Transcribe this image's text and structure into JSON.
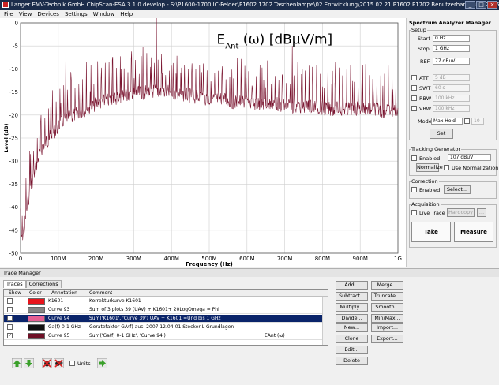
{
  "window": {
    "title": "Langer EMV-Technik GmbH ChipScan-ESA 3.1.0 develop - S:\\P1600-1700 IC-Felder\\P1602 1702 Taschenlampe\\02 Entwicklung\\2015.02.21 P1602 P1702 Benutzerhandbuch\\2015.04.24-01 IC..."
  },
  "menu": [
    "File",
    "View",
    "Devices",
    "Settings",
    "Window",
    "Help"
  ],
  "chart_data": {
    "type": "line",
    "title": "E",
    "title_sub": "Ant",
    "title_rest": " (ω) [dBµV/m]",
    "xlabel": "Frequency (Hz)",
    "ylabel": "Level (dB)",
    "xlim": [
      0,
      1000
    ],
    "ylim": [
      -50,
      0
    ],
    "x_ticks": [
      "0",
      "100M",
      "200M",
      "300M",
      "400M",
      "500M",
      "600M",
      "700M",
      "800M",
      "900M",
      "1G"
    ],
    "y_ticks": [
      "0",
      "-5",
      "-10",
      "-15",
      "-20",
      "-25",
      "-30",
      "-35",
      "-40",
      "-45",
      "-50"
    ],
    "grid": true,
    "series": [
      {
        "color": "#7a1530",
        "x": [
          0,
          10,
          20,
          30,
          40,
          50,
          60,
          70,
          80,
          90,
          100,
          120,
          140,
          160,
          180,
          200,
          220,
          240,
          260,
          280,
          300,
          320,
          340,
          360,
          380,
          400,
          420,
          440,
          460,
          480,
          500,
          520,
          540,
          560,
          580,
          600,
          620,
          640,
          660,
          680,
          700,
          720,
          740,
          760,
          780,
          800,
          820,
          840,
          860,
          880,
          900,
          920,
          940,
          960,
          980,
          1000
        ],
        "y": [
          -46,
          -43,
          -37,
          -33,
          -30,
          -27,
          -25,
          -24,
          -23,
          -22,
          -21,
          -19,
          -18.5,
          -17.5,
          -17,
          -16,
          -15.5,
          -15,
          -14.5,
          -14,
          -14,
          -13.5,
          -13.5,
          -13,
          -13.5,
          -13.5,
          -14,
          -14,
          -14.5,
          -14.5,
          -15,
          -15,
          -15,
          -15.5,
          -15.5,
          -15.5,
          -16,
          -16,
          -16,
          -16,
          -16.5,
          -16.5,
          -16.5,
          -16.5,
          -16.5,
          -17,
          -17,
          -17,
          -17,
          -17,
          -17,
          -17,
          -17,
          -17.5,
          -17.5,
          -17
        ]
      }
    ],
    "peaks": [
      {
        "x": 360,
        "y": 3
      },
      {
        "x": 120,
        "y": -6
      },
      {
        "x": 243,
        "y": -8
      },
      {
        "x": 301,
        "y": -12
      },
      {
        "x": 375,
        "y": -11
      },
      {
        "x": 412,
        "y": -11
      },
      {
        "x": 720,
        "y": -5
      },
      {
        "x": 598,
        "y": -12
      },
      {
        "x": 650,
        "y": -14
      },
      {
        "x": 833,
        "y": -13
      }
    ]
  },
  "analyzer": {
    "panel_title": "Spectrum Analyzer Manager",
    "setup_label": "Setup",
    "start_label": "Start",
    "start_value": "0 Hz",
    "stop_label": "Stop",
    "stop_value": "1 GHz",
    "ref_label": "REF",
    "ref_value": "77 dBuV",
    "att_label": "ATT",
    "att_value": "5 dB",
    "swt_label": "SWT",
    "swt_value": "60 s",
    "rbw_label": "RBW",
    "rbw_value": "100 kHz",
    "vbw_label": "VBW",
    "vbw_value": "100 kHz",
    "mode_label": "Mode",
    "mode_value": "Max Hold",
    "mode_count": "10",
    "set_label": "Set",
    "tracking_label": "Tracking Generator",
    "tg_enabled_label": "Enabled",
    "tg_level": "107 dBuV",
    "normalize_label": "Normalize",
    "use_norm_label": "Use Normalization",
    "correction_label": "Correction",
    "corr_enabled_label": "Enabled",
    "select_label": "Select...",
    "acquisition_label": "Acquisition",
    "live_trace_label": "Live Trace",
    "hardcopy_label": "Hardcopy",
    "take_label": "Take",
    "measure_label": "Measure"
  },
  "trace_manager": {
    "title": "Trace Manager",
    "tabs": [
      "Traces",
      "Corrections"
    ],
    "headers": [
      "Show",
      "Color",
      "Annotation",
      "Comment"
    ],
    "rows": [
      {
        "checked": false,
        "color": "#e8141c",
        "annotation": "K1601",
        "comment": "Korrekturkurve K1601",
        "extra": ""
      },
      {
        "checked": false,
        "color": "#848484",
        "annotation": "Curve 93",
        "comment": "Sum of 3 plots 39 (UAV) + K1601+ 20LogOmega = Phi",
        "extra": ""
      },
      {
        "checked": false,
        "color": "#e55f93",
        "annotation": "Curve 94",
        "comment": "Sum('K1601', 'Curve 39') UAV + K1601 =Und bis 1 GHz",
        "extra": ""
      },
      {
        "checked": false,
        "color": "#111111",
        "annotation": "Ga(f) 0-1 GHz",
        "comment": "Geratefaktor GA(f)   aus: 2007.12.04-01 Stecker L Grundlagen",
        "extra": ""
      },
      {
        "checked": true,
        "color": "#6e1026",
        "annotation": "Curve 95",
        "comment": "Sum('Ga(f) 0-1 GHz', 'Curve 94')",
        "extra": "EAnt (ω)"
      }
    ],
    "buttons_col1": [
      "Add...",
      "Subtract...",
      "Multiply...",
      "Divide..."
    ],
    "buttons_col1b": [
      "New...",
      "Clone",
      "Edit...",
      "Delete"
    ],
    "buttons_col2": [
      "Merge...",
      "Truncate...",
      "Smooth...",
      "Min/Max..."
    ],
    "buttons_col2b": [
      "Import...",
      "Export..."
    ],
    "units_label": "Units"
  }
}
